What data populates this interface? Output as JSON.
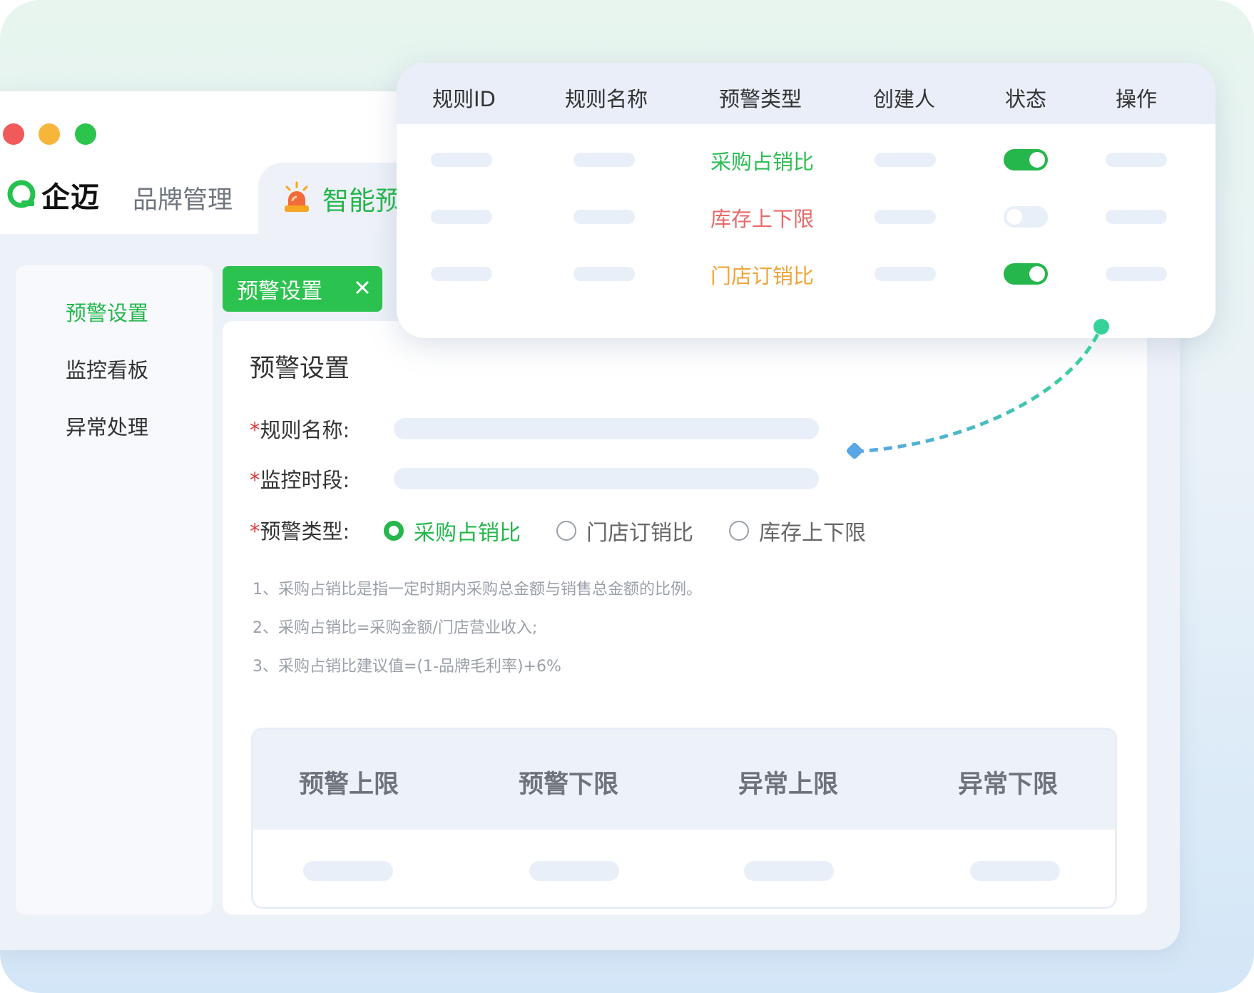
{
  "app": {
    "logo_text": "企迈",
    "tab_brand": "品牌管理",
    "tab_active": "智能预",
    "colors": {
      "accent": "#25b64c",
      "danger": "#e86a6a",
      "warning": "#f0a43a"
    }
  },
  "sidebar": {
    "items": [
      {
        "label": "预警设置",
        "active": true
      },
      {
        "label": "监控看板",
        "active": false
      },
      {
        "label": "异常处理",
        "active": false
      }
    ]
  },
  "open_tab": {
    "label": "预警设置",
    "close_icon": "close-icon"
  },
  "form": {
    "title": "预警设置",
    "required_mark": "*",
    "rule_name_label": "规则名称:",
    "monitor_period_label": "监控时段:",
    "warn_type_label": "预警类型:",
    "warn_types": [
      {
        "label": "采购占销比",
        "checked": true
      },
      {
        "label": "门店订销比",
        "checked": false
      },
      {
        "label": "库存上下限",
        "checked": false
      }
    ],
    "notes": [
      "1、采购占销比是指一定时期内采购总金额与销售总金额的比例。",
      "2、采购占销比=采购金额/门店营业收入;",
      "3、采购占销比建议值=(1-品牌毛利率)+6%"
    ],
    "limit_table": {
      "columns": [
        "预警上限",
        "预警下限",
        "异常上限",
        "异常下限"
      ]
    }
  },
  "rule_table": {
    "columns": [
      "规则ID",
      "规则名称",
      "预警类型",
      "创建人",
      "状态",
      "操作"
    ],
    "rows": [
      {
        "type": "采购占销比",
        "type_color": "#2fbd55",
        "enabled": true
      },
      {
        "type": "库存上下限",
        "type_color": "#e86a6a",
        "enabled": false
      },
      {
        "type": "门店订销比",
        "type_color": "#f0a43a",
        "enabled": true
      }
    ]
  }
}
